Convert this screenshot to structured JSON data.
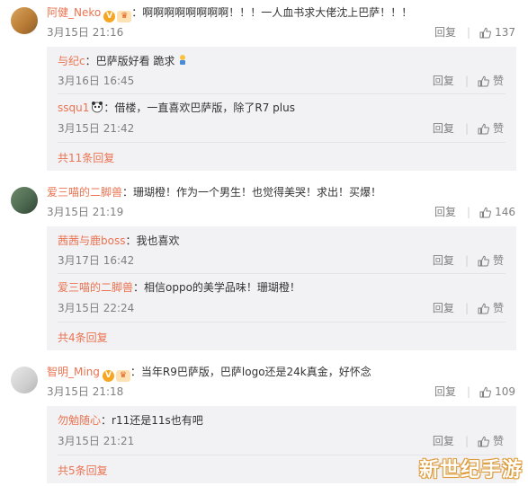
{
  "comments": [
    {
      "user": "阿健_Neko",
      "content": "：啊啊啊啊啊啊啊啊！！！一人血书求大佬沈上巴萨！！！",
      "time": "3月15日 21:16",
      "reply_label": "回复",
      "likes": "137",
      "replies": [
        {
          "user": "与纪c",
          "content": "：巴萨版好看 跪求",
          "time": "3月16日 16:45",
          "likes": "赞"
        },
        {
          "user": "ssqu1",
          "content": "：借楼，一直喜欢巴萨版，除了R7 plus",
          "time": "3月15日 21:42",
          "likes": "赞"
        }
      ],
      "more": "共11条回复"
    },
    {
      "user": "爱三喵的二脚兽",
      "content": "：珊瑚橙！作为一个男生！也觉得美哭！求出！买爆！",
      "time": "3月15日 21:19",
      "reply_label": "回复",
      "likes": "146",
      "replies": [
        {
          "user": "茜茜与鹿boss",
          "content": "：我也喜欢",
          "time": "3月17日 16:42",
          "likes": "赞"
        },
        {
          "user": "爱三喵的二脚兽",
          "content": "：相信oppo的美学品味！珊瑚橙！",
          "time": "3月15日 22:24",
          "likes": "赞"
        }
      ],
      "more": "共4条回复"
    },
    {
      "user": "智明_Ming",
      "content": "：当年R9巴萨版，巴萨logo还是24k真金，好怀念",
      "time": "3月15日 21:18",
      "reply_label": "回复",
      "likes": "109",
      "replies": [
        {
          "user": "勿勉随心",
          "content": "：r11还是11s也有吧",
          "time": "3月15日 21:21",
          "likes": "赞"
        }
      ],
      "more": "共5条回复"
    }
  ],
  "reply_label": "回复",
  "watermark": "新世纪手游",
  "colors": {
    "username": "#eb7350",
    "meta": "#808080",
    "reply_bg": "#f2f2f5"
  }
}
